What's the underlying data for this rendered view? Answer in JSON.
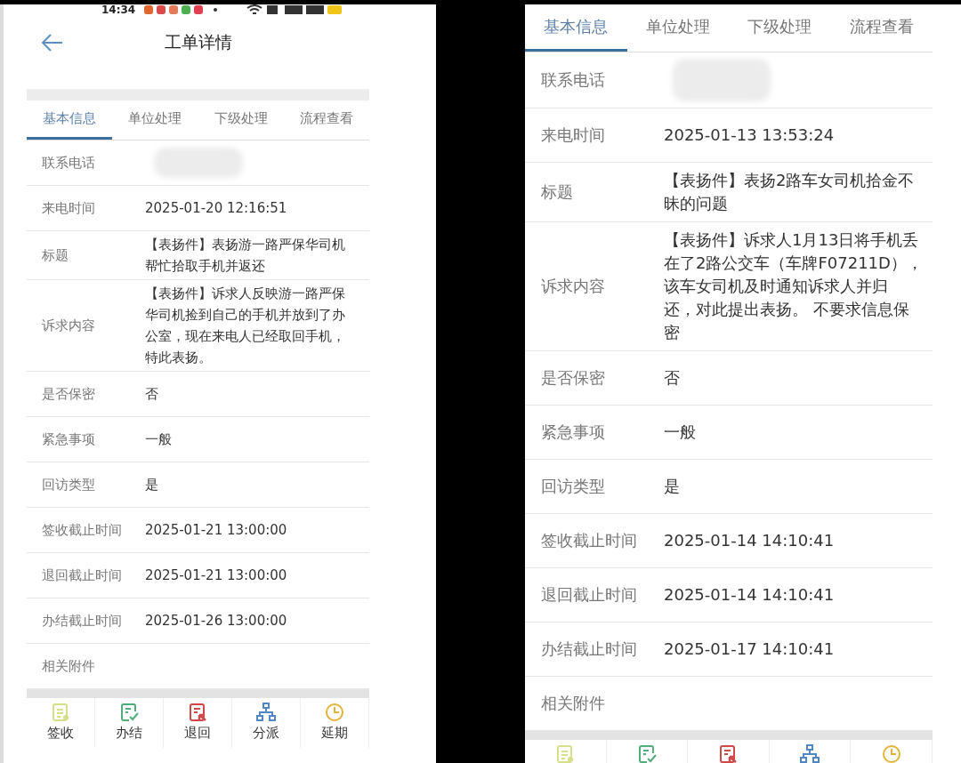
{
  "screens": [
    {
      "status_bar": {
        "time": "14:34"
      },
      "header": {
        "title": "工单详情"
      },
      "tabs": [
        {
          "label": "基本信息",
          "selected": true
        },
        {
          "label": "单位处理",
          "selected": false
        },
        {
          "label": "下级处理",
          "selected": false
        },
        {
          "label": "流程查看",
          "selected": false
        }
      ],
      "fields": [
        {
          "kind": "blurred",
          "label": "联系电话"
        },
        {
          "kind": "text",
          "label": "来电时间",
          "value": [
            "2025-01-20 12:16:51"
          ]
        },
        {
          "kind": "text",
          "label": "标题",
          "value": [
            "【表扬件】表扬游一路严保华司机",
            "帮忙拾取手机并返还"
          ]
        },
        {
          "kind": "text",
          "label": "诉求内容",
          "value": [
            "【表扬件】诉求人反映游一路严保",
            "华司机捡到自己的手机并放到了办",
            "公室，现在来电人已经取回手机，",
            "特此表扬。"
          ]
        },
        {
          "kind": "text",
          "label": "是否保密",
          "value": [
            "否"
          ]
        },
        {
          "kind": "text",
          "label": "紧急事项",
          "value": [
            "一般"
          ]
        },
        {
          "kind": "text",
          "label": "回访类型",
          "value": [
            "是"
          ]
        },
        {
          "kind": "text",
          "label": "签收截止时间",
          "value": [
            "2025-01-21 13:00:00"
          ]
        },
        {
          "kind": "text",
          "label": "退回截止时间",
          "value": [
            "2025-01-21 13:00:00"
          ]
        },
        {
          "kind": "text",
          "label": "办结截止时间",
          "value": [
            "2025-01-26 13:00:00"
          ]
        },
        {
          "kind": "text",
          "label": "相关附件"
        }
      ],
      "actions": [
        {
          "kind": "sign",
          "label": "签收"
        },
        {
          "kind": "complete",
          "label": "办结"
        },
        {
          "kind": "return",
          "label": "退回"
        },
        {
          "kind": "dispatch",
          "label": "分派"
        },
        {
          "kind": "extend",
          "label": "延期"
        }
      ]
    },
    {
      "tabs": [
        {
          "label": "基本信息",
          "selected": true
        },
        {
          "label": "单位处理",
          "selected": false
        },
        {
          "label": "下级处理",
          "selected": false
        },
        {
          "label": "流程查看",
          "selected": false
        }
      ],
      "fields": [
        {
          "kind": "blurred",
          "label": "联系电话"
        },
        {
          "kind": "text",
          "label": "来电时间",
          "value": [
            "2025-01-13 13:53:24"
          ]
        },
        {
          "kind": "text",
          "label": "标题",
          "value": [
            "【表扬件】表扬2路车女司机拾金不",
            "昧的问题"
          ]
        },
        {
          "kind": "text",
          "label": "诉求内容",
          "value": [
            "【表扬件】诉求人1月13日将手机丢",
            "在了2路公交车（车牌F07211D），",
            "该车女司机及时通知诉求人并归",
            "还，对此提出表扬。 不要求信息保",
            "密"
          ]
        },
        {
          "kind": "text",
          "label": "是否保密",
          "value": [
            "否"
          ]
        },
        {
          "kind": "text",
          "label": "紧急事项",
          "value": [
            "一般"
          ]
        },
        {
          "kind": "text",
          "label": "回访类型",
          "value": [
            "是"
          ]
        },
        {
          "kind": "text",
          "label": "签收截止时间",
          "value": [
            "2025-01-14 14:10:41"
          ]
        },
        {
          "kind": "text",
          "label": "退回截止时间",
          "value": [
            "2025-01-14 14:10:41"
          ]
        },
        {
          "kind": "text",
          "label": "办结截止时间",
          "value": [
            "2025-01-17 14:10:41"
          ]
        },
        {
          "kind": "text",
          "label": "相关附件"
        }
      ],
      "actions": [
        {
          "kind": "sign"
        },
        {
          "kind": "complete"
        },
        {
          "kind": "return"
        },
        {
          "kind": "dispatch"
        },
        {
          "kind": "extend"
        }
      ]
    }
  ]
}
